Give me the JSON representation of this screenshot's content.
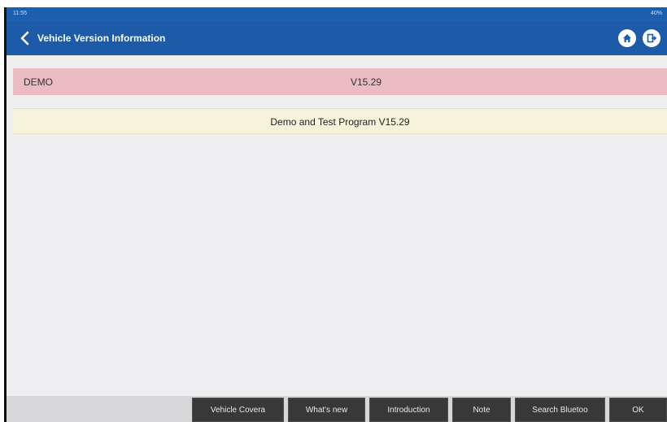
{
  "statusbar": {
    "time": "11:55",
    "battery": "40%"
  },
  "header": {
    "title": "Vehicle Version Information",
    "back_icon": "chevron-left-icon",
    "home_icon": "home-icon",
    "exit_icon": "exit-icon"
  },
  "rows": [
    {
      "name": "DEMO",
      "version": "V15.29"
    }
  ],
  "info_row": {
    "text": "Demo and Test Program V15.29"
  },
  "footer_buttons": [
    {
      "label": "Vehicle Covera"
    },
    {
      "label": "What's new"
    },
    {
      "label": "Introduction"
    },
    {
      "label": "Note"
    },
    {
      "label": "Search Bluetoo"
    },
    {
      "label": "OK"
    }
  ],
  "colors": {
    "appbar": "#1d5ba8",
    "row_highlight": "#eabbc0",
    "info_row": "#f6f3da",
    "button": "#383838"
  }
}
